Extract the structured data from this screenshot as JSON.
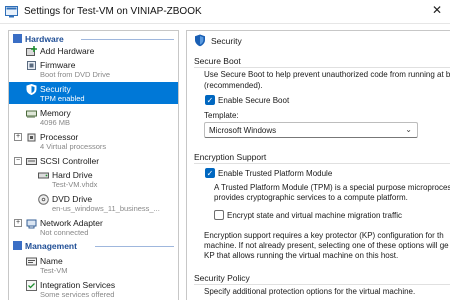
{
  "window": {
    "title": "Settings for Test-VM on VINIAP-ZBOOK",
    "close_glyph": "✕"
  },
  "sidebar": {
    "hardware_header": "Hardware",
    "management_header": "Management",
    "items": [
      {
        "id": "add-hardware",
        "name": "Add Hardware",
        "sub": ""
      },
      {
        "id": "firmware",
        "name": "Firmware",
        "sub": "Boot from DVD Drive"
      },
      {
        "id": "security",
        "name": "Security",
        "sub": "TPM enabled"
      },
      {
        "id": "memory",
        "name": "Memory",
        "sub": "4096 MB"
      },
      {
        "id": "processor",
        "name": "Processor",
        "sub": "4 Virtual processors"
      },
      {
        "id": "scsi-controller",
        "name": "SCSI Controller",
        "sub": ""
      },
      {
        "id": "hard-drive",
        "name": "Hard Drive",
        "sub": "Test-VM.vhdx"
      },
      {
        "id": "dvd-drive",
        "name": "DVD Drive",
        "sub": "en-us_windows_11_business_..."
      },
      {
        "id": "network-adapter",
        "name": "Network Adapter",
        "sub": "Not connected"
      },
      {
        "id": "name",
        "name": "Name",
        "sub": "Test-VM"
      },
      {
        "id": "integration-services",
        "name": "Integration Services",
        "sub": "Some services offered"
      }
    ]
  },
  "content": {
    "header": "Security",
    "secure_boot": {
      "heading": "Secure Boot",
      "description_1": "Use Secure Boot to help prevent unauthorized code from running at b",
      "description_2": "(recommended).",
      "checkbox_label": "Enable Secure Boot",
      "checked": true,
      "template_label": "Template:",
      "template_value": "Microsoft Windows"
    },
    "encryption": {
      "heading": "Encryption Support",
      "tpm_label": "Enable Trusted Platform Module",
      "tpm_checked": true,
      "tpm_desc_1": "A Trusted Platform Module (TPM) is a special purpose microproces",
      "tpm_desc_2": "provides cryptographic services to a compute platform.",
      "encrypt_label": "Encrypt state and virtual machine migration traffic",
      "encrypt_checked": false,
      "support_1": "Encryption support requires a key protector (KP) configuration for th",
      "support_2": "machine. If not already present, selecting one of these options will ge",
      "support_3": "KP that allows running the virtual machine on this host."
    },
    "policy": {
      "heading": "Security Policy",
      "description": "Specify additional protection options for the virtual machine."
    }
  },
  "colors": {
    "accent": "#0078d7",
    "section_header": "#1f4e96",
    "checkbox": "#0067c0"
  }
}
